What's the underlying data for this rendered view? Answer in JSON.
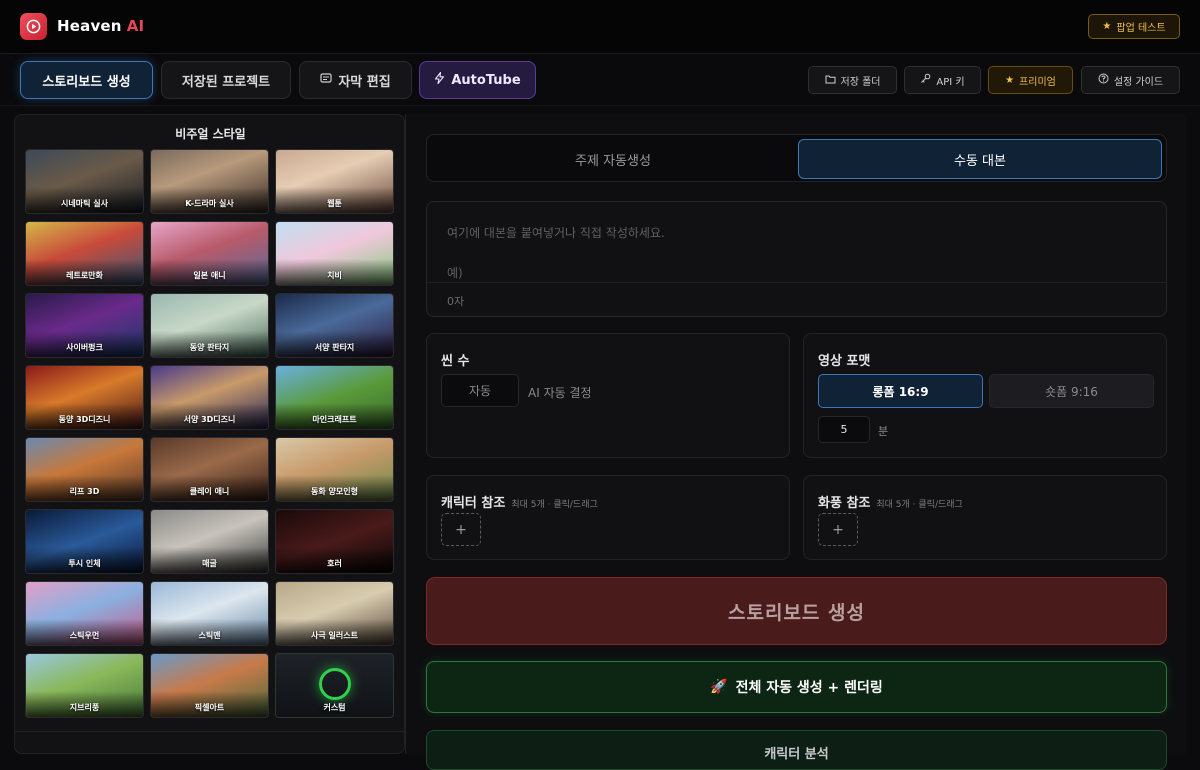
{
  "header": {
    "brand_main": "Heaven",
    "brand_accent": "AI",
    "popup_test_label": "팝업 테스트"
  },
  "nav": {
    "tabs": [
      {
        "label": "스토리보드 생성",
        "active": true
      },
      {
        "label": "저장된 프로젝트"
      },
      {
        "label": "자막 편집"
      },
      {
        "label": "AutoTube"
      }
    ],
    "tools": [
      {
        "label": "저장 폴더",
        "icon": "folder-icon"
      },
      {
        "label": "API 키",
        "icon": "key-icon"
      },
      {
        "label": "프리미엄",
        "icon": "star-icon"
      },
      {
        "label": "설정 가이드",
        "icon": "help-icon"
      }
    ]
  },
  "visual_style": {
    "title": "비주얼 스타일",
    "styles": [
      {
        "label": "시네마틱 실사",
        "bg": "linear-gradient(160deg,#3c4a58 0%,#6a5a48 45%,#1a1e26 100%)"
      },
      {
        "label": "K-드라마 실사",
        "bg": "linear-gradient(160deg,#7a6a5c 0%,#b89a7c 40%,#3a2e28 100%)"
      },
      {
        "label": "웹툰",
        "bg": "linear-gradient(160deg,#c9a890 0%,#e6cdb4 40%,#6a4a3c 100%)"
      },
      {
        "label": "레트로만화",
        "bg": "linear-gradient(160deg,#d4b64a 0%,#c84a3a 45%,#3a5a7a 100%)"
      },
      {
        "label": "일본 애니",
        "bg": "linear-gradient(160deg,#e6a6c8 0%,#b85a6a 45%,#5a6a9a 100%)"
      },
      {
        "label": "치비",
        "bg": "linear-gradient(160deg,#bfe0f0 0%,#f0c8dc 45%,#8ac880 100%)"
      },
      {
        "label": "사이버펑크",
        "bg": "linear-gradient(160deg,#2a1a4a 0%,#6a2a8a 45%,#1a3a6a 100%)"
      },
      {
        "label": "동양 판타지",
        "bg": "linear-gradient(160deg,#9ab8b0 0%,#c8d8c8 45%,#4a6a5a 100%)"
      },
      {
        "label": "서양 판타지",
        "bg": "linear-gradient(160deg,#1a2a4a 0%,#4a6a9a 45%,#2a1a3a 100%)"
      },
      {
        "label": "동양 3D디즈니",
        "bg": "linear-gradient(160deg,#8a1a1a 0%,#d87a2a 45%,#4a1a1a 100%)"
      },
      {
        "label": "서양 3D디즈니",
        "bg": "linear-gradient(160deg,#4a3a8a 0%,#c89a6a 45%,#2a2a5a 100%)"
      },
      {
        "label": "마인크래프트",
        "bg": "linear-gradient(160deg,#6ab0e0 0%,#5a9a3a 50%,#3a6a2a 100%)"
      },
      {
        "label": "리프 3D",
        "bg": "linear-gradient(160deg,#6a8ab0 0%,#c8783a 45%,#5a3a2a 100%)"
      },
      {
        "label": "클레이 애니",
        "bg": "linear-gradient(160deg,#5a3a2a 0%,#9a6a4a 45%,#3a2418 100%)"
      },
      {
        "label": "동화 양모인형",
        "bg": "linear-gradient(160deg,#d8c8a8 0%,#c89a6a 45%,#6a8a4a 100%)"
      },
      {
        "label": "투시 인체",
        "bg": "linear-gradient(160deg,#0a1a3a 0%,#2a5a9a 50%,#0a1a3a 100%)"
      },
      {
        "label": "매글",
        "bg": "linear-gradient(160deg,#8a8a88 0%,#c8c4bc 45%,#3a3a3a 100%)"
      },
      {
        "label": "호러",
        "bg": "linear-gradient(160deg,#1a0a0a 0%,#4a1a1a 50%,#0a0606 100%)"
      },
      {
        "label": "스틱우먼",
        "bg": "linear-gradient(160deg,#e0a0c8 0%,#8ab0e0 45%,#c85a8a 100%)"
      },
      {
        "label": "스틱맨",
        "bg": "linear-gradient(160deg,#9ab8d8 0%,#dce6ee 45%,#6a8aa8 100%)"
      },
      {
        "label": "사극 일러스트",
        "bg": "linear-gradient(160deg,#b8a888 0%,#d8ccb0 45%,#5a4a3a 100%)"
      },
      {
        "label": "지브리풍",
        "bg": "linear-gradient(160deg,#9ac8e0 0%,#8ab85a 45%,#4a7a3a 100%)"
      },
      {
        "label": "픽셀아트",
        "bg": "linear-gradient(160deg,#6a9ac8 0%,#c87a4a 45%,#4a6a3a 100%)"
      },
      {
        "label": "커스텀",
        "bg": "linear-gradient(180deg,#1e2228 0%,#101216 100%)",
        "custom": true
      }
    ]
  },
  "script_mode": {
    "options": [
      {
        "label": "주제 자동생성"
      },
      {
        "label": "수동 대본",
        "active": true
      }
    ]
  },
  "script_editor": {
    "placeholder": "여기에 대본을 붙여넣거나 직접 작성하세요.",
    "example_prefix": "예)",
    "char_count": "0자"
  },
  "scene_count": {
    "title": "씬 수",
    "value": "자동",
    "note": "AI 자동 결정"
  },
  "video_format": {
    "title": "영상 포맷",
    "options": [
      {
        "label": "롱폼 16:9",
        "active": true
      },
      {
        "label": "숏폼 9:16"
      }
    ],
    "minutes_value": "5",
    "minutes_unit": "분"
  },
  "character_ref": {
    "title": "캐릭터 참조",
    "hint": "최대 5개 · 클릭/드래그",
    "add_label": "+"
  },
  "style_ref": {
    "title": "화풍 참조",
    "hint": "최대 5개 · 클릭/드래그",
    "add_label": "+"
  },
  "actions": {
    "generate_label": "스토리보드 생성",
    "auto_render_icon": "🚀",
    "auto_render_label": "전체 자동 생성 + 렌더링",
    "extra_label": "캐릭터 분석"
  },
  "colors": {
    "accent_blue": "#3a78b8",
    "brand_red": "#e34656",
    "premium_gold": "#f0c04a",
    "success_green": "#2a7a3c"
  }
}
